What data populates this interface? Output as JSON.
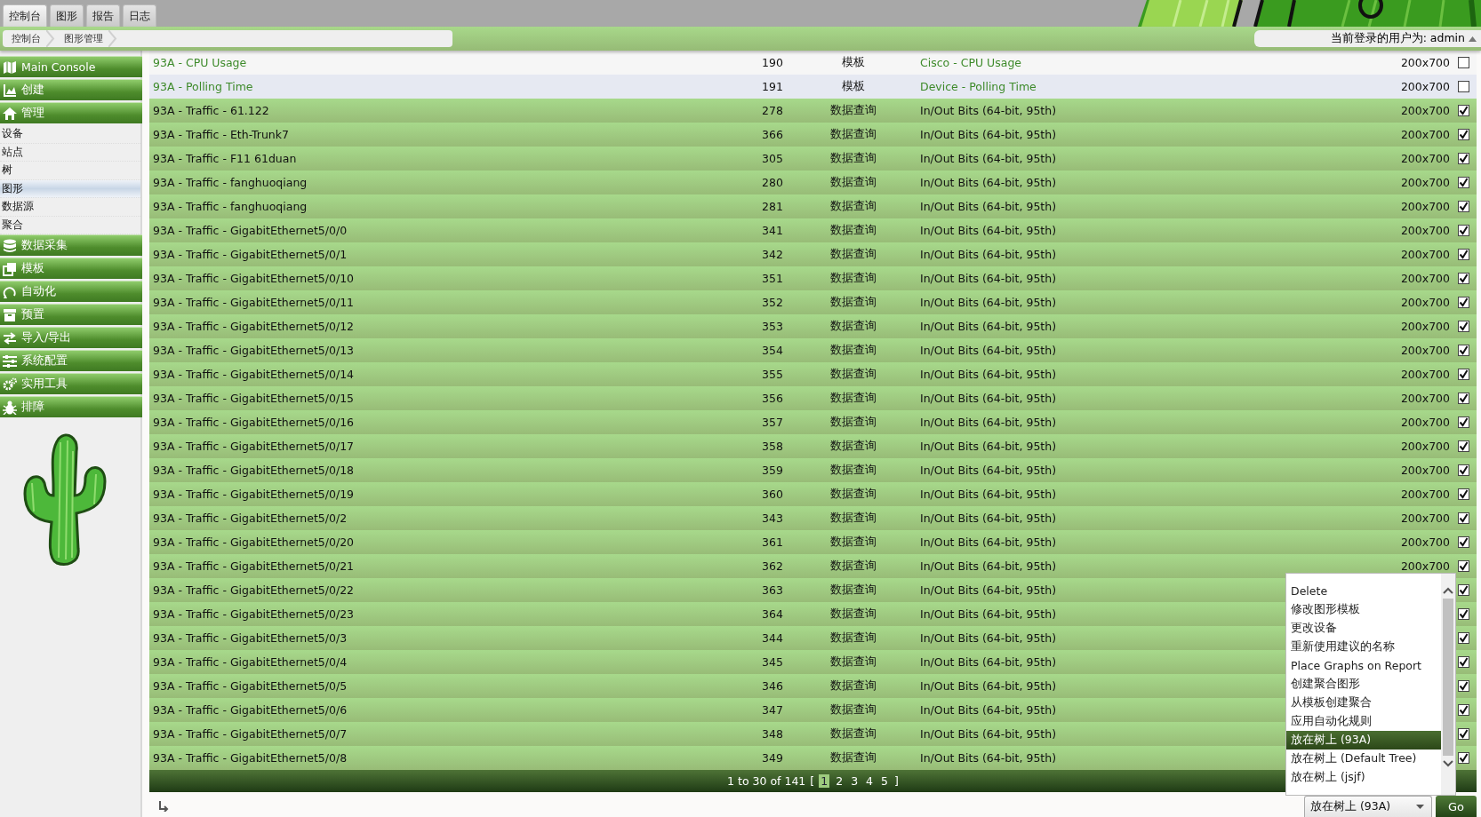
{
  "top_tabs": [
    {
      "label": "控制台",
      "selected": true
    },
    {
      "label": "图形",
      "selected": false
    },
    {
      "label": "报告",
      "selected": false
    },
    {
      "label": "日志",
      "selected": false
    }
  ],
  "breadcrumb": [
    "控制台",
    "图形管理"
  ],
  "user_status": "当前登录的用户为: admin",
  "sidebar": [
    {
      "kind": "header",
      "label": "Main Console"
    },
    {
      "kind": "header",
      "label": "创建"
    },
    {
      "kind": "header",
      "label": "管理"
    },
    {
      "kind": "item",
      "label": "设备",
      "selected": false
    },
    {
      "kind": "item",
      "label": "站点",
      "selected": false
    },
    {
      "kind": "item",
      "label": "树",
      "selected": false
    },
    {
      "kind": "item",
      "label": "图形",
      "selected": true
    },
    {
      "kind": "item",
      "label": "数据源",
      "selected": false
    },
    {
      "kind": "item",
      "label": "聚合",
      "selected": false
    },
    {
      "kind": "header",
      "label": "数据采集"
    },
    {
      "kind": "header",
      "label": "模板"
    },
    {
      "kind": "header",
      "label": "自动化"
    },
    {
      "kind": "header",
      "label": "预置"
    },
    {
      "kind": "header",
      "label": "导入/导出"
    },
    {
      "kind": "header",
      "label": "系统配置"
    },
    {
      "kind": "header",
      "label": "实用工具"
    },
    {
      "kind": "header",
      "label": "排障"
    }
  ],
  "table": {
    "rows": [
      {
        "name": "93A - CPU Usage",
        "id": "190",
        "type": "模板",
        "template": "Cisco - CPU Usage",
        "size": "200x700",
        "checked": false
      },
      {
        "name": "93A - Polling Time",
        "id": "191",
        "type": "模板",
        "template": "Device - Polling Time",
        "size": "200x700",
        "checked": false
      },
      {
        "name": "93A - Traffic - 61.122",
        "id": "278",
        "type": "数据查询",
        "template": "In/Out Bits (64-bit, 95th)",
        "size": "200x700",
        "checked": true
      },
      {
        "name": "93A - Traffic - Eth-Trunk7",
        "id": "366",
        "type": "数据查询",
        "template": "In/Out Bits (64-bit, 95th)",
        "size": "200x700",
        "checked": true
      },
      {
        "name": "93A - Traffic - F11 61duan",
        "id": "305",
        "type": "数据查询",
        "template": "In/Out Bits (64-bit, 95th)",
        "size": "200x700",
        "checked": true
      },
      {
        "name": "93A - Traffic - fanghuoqiang",
        "id": "280",
        "type": "数据查询",
        "template": "In/Out Bits (64-bit, 95th)",
        "size": "200x700",
        "checked": true
      },
      {
        "name": "93A - Traffic - fanghuoqiang",
        "id": "281",
        "type": "数据查询",
        "template": "In/Out Bits (64-bit, 95th)",
        "size": "200x700",
        "checked": true
      },
      {
        "name": "93A - Traffic - GigabitEthernet5/0/0",
        "id": "341",
        "type": "数据查询",
        "template": "In/Out Bits (64-bit, 95th)",
        "size": "200x700",
        "checked": true
      },
      {
        "name": "93A - Traffic - GigabitEthernet5/0/1",
        "id": "342",
        "type": "数据查询",
        "template": "In/Out Bits (64-bit, 95th)",
        "size": "200x700",
        "checked": true
      },
      {
        "name": "93A - Traffic - GigabitEthernet5/0/10",
        "id": "351",
        "type": "数据查询",
        "template": "In/Out Bits (64-bit, 95th)",
        "size": "200x700",
        "checked": true
      },
      {
        "name": "93A - Traffic - GigabitEthernet5/0/11",
        "id": "352",
        "type": "数据查询",
        "template": "In/Out Bits (64-bit, 95th)",
        "size": "200x700",
        "checked": true
      },
      {
        "name": "93A - Traffic - GigabitEthernet5/0/12",
        "id": "353",
        "type": "数据查询",
        "template": "In/Out Bits (64-bit, 95th)",
        "size": "200x700",
        "checked": true
      },
      {
        "name": "93A - Traffic - GigabitEthernet5/0/13",
        "id": "354",
        "type": "数据查询",
        "template": "In/Out Bits (64-bit, 95th)",
        "size": "200x700",
        "checked": true
      },
      {
        "name": "93A - Traffic - GigabitEthernet5/0/14",
        "id": "355",
        "type": "数据查询",
        "template": "In/Out Bits (64-bit, 95th)",
        "size": "200x700",
        "checked": true
      },
      {
        "name": "93A - Traffic - GigabitEthernet5/0/15",
        "id": "356",
        "type": "数据查询",
        "template": "In/Out Bits (64-bit, 95th)",
        "size": "200x700",
        "checked": true
      },
      {
        "name": "93A - Traffic - GigabitEthernet5/0/16",
        "id": "357",
        "type": "数据查询",
        "template": "In/Out Bits (64-bit, 95th)",
        "size": "200x700",
        "checked": true
      },
      {
        "name": "93A - Traffic - GigabitEthernet5/0/17",
        "id": "358",
        "type": "数据查询",
        "template": "In/Out Bits (64-bit, 95th)",
        "size": "200x700",
        "checked": true
      },
      {
        "name": "93A - Traffic - GigabitEthernet5/0/18",
        "id": "359",
        "type": "数据查询",
        "template": "In/Out Bits (64-bit, 95th)",
        "size": "200x700",
        "checked": true
      },
      {
        "name": "93A - Traffic - GigabitEthernet5/0/19",
        "id": "360",
        "type": "数据查询",
        "template": "In/Out Bits (64-bit, 95th)",
        "size": "200x700",
        "checked": true
      },
      {
        "name": "93A - Traffic - GigabitEthernet5/0/2",
        "id": "343",
        "type": "数据查询",
        "template": "In/Out Bits (64-bit, 95th)",
        "size": "200x700",
        "checked": true
      },
      {
        "name": "93A - Traffic - GigabitEthernet5/0/20",
        "id": "361",
        "type": "数据查询",
        "template": "In/Out Bits (64-bit, 95th)",
        "size": "200x700",
        "checked": true
      },
      {
        "name": "93A - Traffic - GigabitEthernet5/0/21",
        "id": "362",
        "type": "数据查询",
        "template": "In/Out Bits (64-bit, 95th)",
        "size": "200x700",
        "checked": true
      },
      {
        "name": "93A - Traffic - GigabitEthernet5/0/22",
        "id": "363",
        "type": "数据查询",
        "template": "In/Out Bits (64-bit, 95th)",
        "checked": true
      },
      {
        "name": "93A - Traffic - GigabitEthernet5/0/23",
        "id": "364",
        "type": "数据查询",
        "template": "In/Out Bits (64-bit, 95th)",
        "checked": true
      },
      {
        "name": "93A - Traffic - GigabitEthernet5/0/3",
        "id": "344",
        "type": "数据查询",
        "template": "In/Out Bits (64-bit, 95th)",
        "checked": true
      },
      {
        "name": "93A - Traffic - GigabitEthernet5/0/4",
        "id": "345",
        "type": "数据查询",
        "template": "In/Out Bits (64-bit, 95th)",
        "checked": true
      },
      {
        "name": "93A - Traffic - GigabitEthernet5/0/5",
        "id": "346",
        "type": "数据查询",
        "template": "In/Out Bits (64-bit, 95th)",
        "checked": true
      },
      {
        "name": "93A - Traffic - GigabitEthernet5/0/6",
        "id": "347",
        "type": "数据查询",
        "template": "In/Out Bits (64-bit, 95th)",
        "checked": true
      },
      {
        "name": "93A - Traffic - GigabitEthernet5/0/7",
        "id": "348",
        "type": "数据查询",
        "template": "In/Out Bits (64-bit, 95th)",
        "checked": true
      },
      {
        "name": "93A - Traffic - GigabitEthernet5/0/8",
        "id": "349",
        "type": "数据查询",
        "template": "In/Out Bits (64-bit, 95th)",
        "checked": true
      }
    ]
  },
  "pagination": {
    "summary": "1 to 30 of 141",
    "open": "[",
    "pages": [
      {
        "label": "1",
        "selected": true
      },
      {
        "label": "2",
        "selected": false
      },
      {
        "label": "3",
        "selected": false
      },
      {
        "label": "4",
        "selected": false
      },
      {
        "label": "5",
        "selected": false
      }
    ],
    "close": "]"
  },
  "action_menu": {
    "options": [
      {
        "label": "Delete",
        "selected": false
      },
      {
        "label": "修改图形模板",
        "selected": false
      },
      {
        "label": "更改设备",
        "selected": false
      },
      {
        "label": "重新使用建议的名称",
        "selected": false
      },
      {
        "label": "Place Graphs on Report",
        "selected": false
      },
      {
        "label": "创建聚合图形",
        "selected": false
      },
      {
        "label": "从模板创建聚合",
        "selected": false
      },
      {
        "label": "应用自动化规则",
        "selected": false
      },
      {
        "label": "放在树上 (93A)",
        "selected": true
      },
      {
        "label": "放在树上 (Default Tree)",
        "selected": false
      },
      {
        "label": "放在树上 (jsjf)",
        "selected": false
      }
    ]
  },
  "action_select": {
    "value": "放在树上 (93A)"
  },
  "go_button": "Go"
}
